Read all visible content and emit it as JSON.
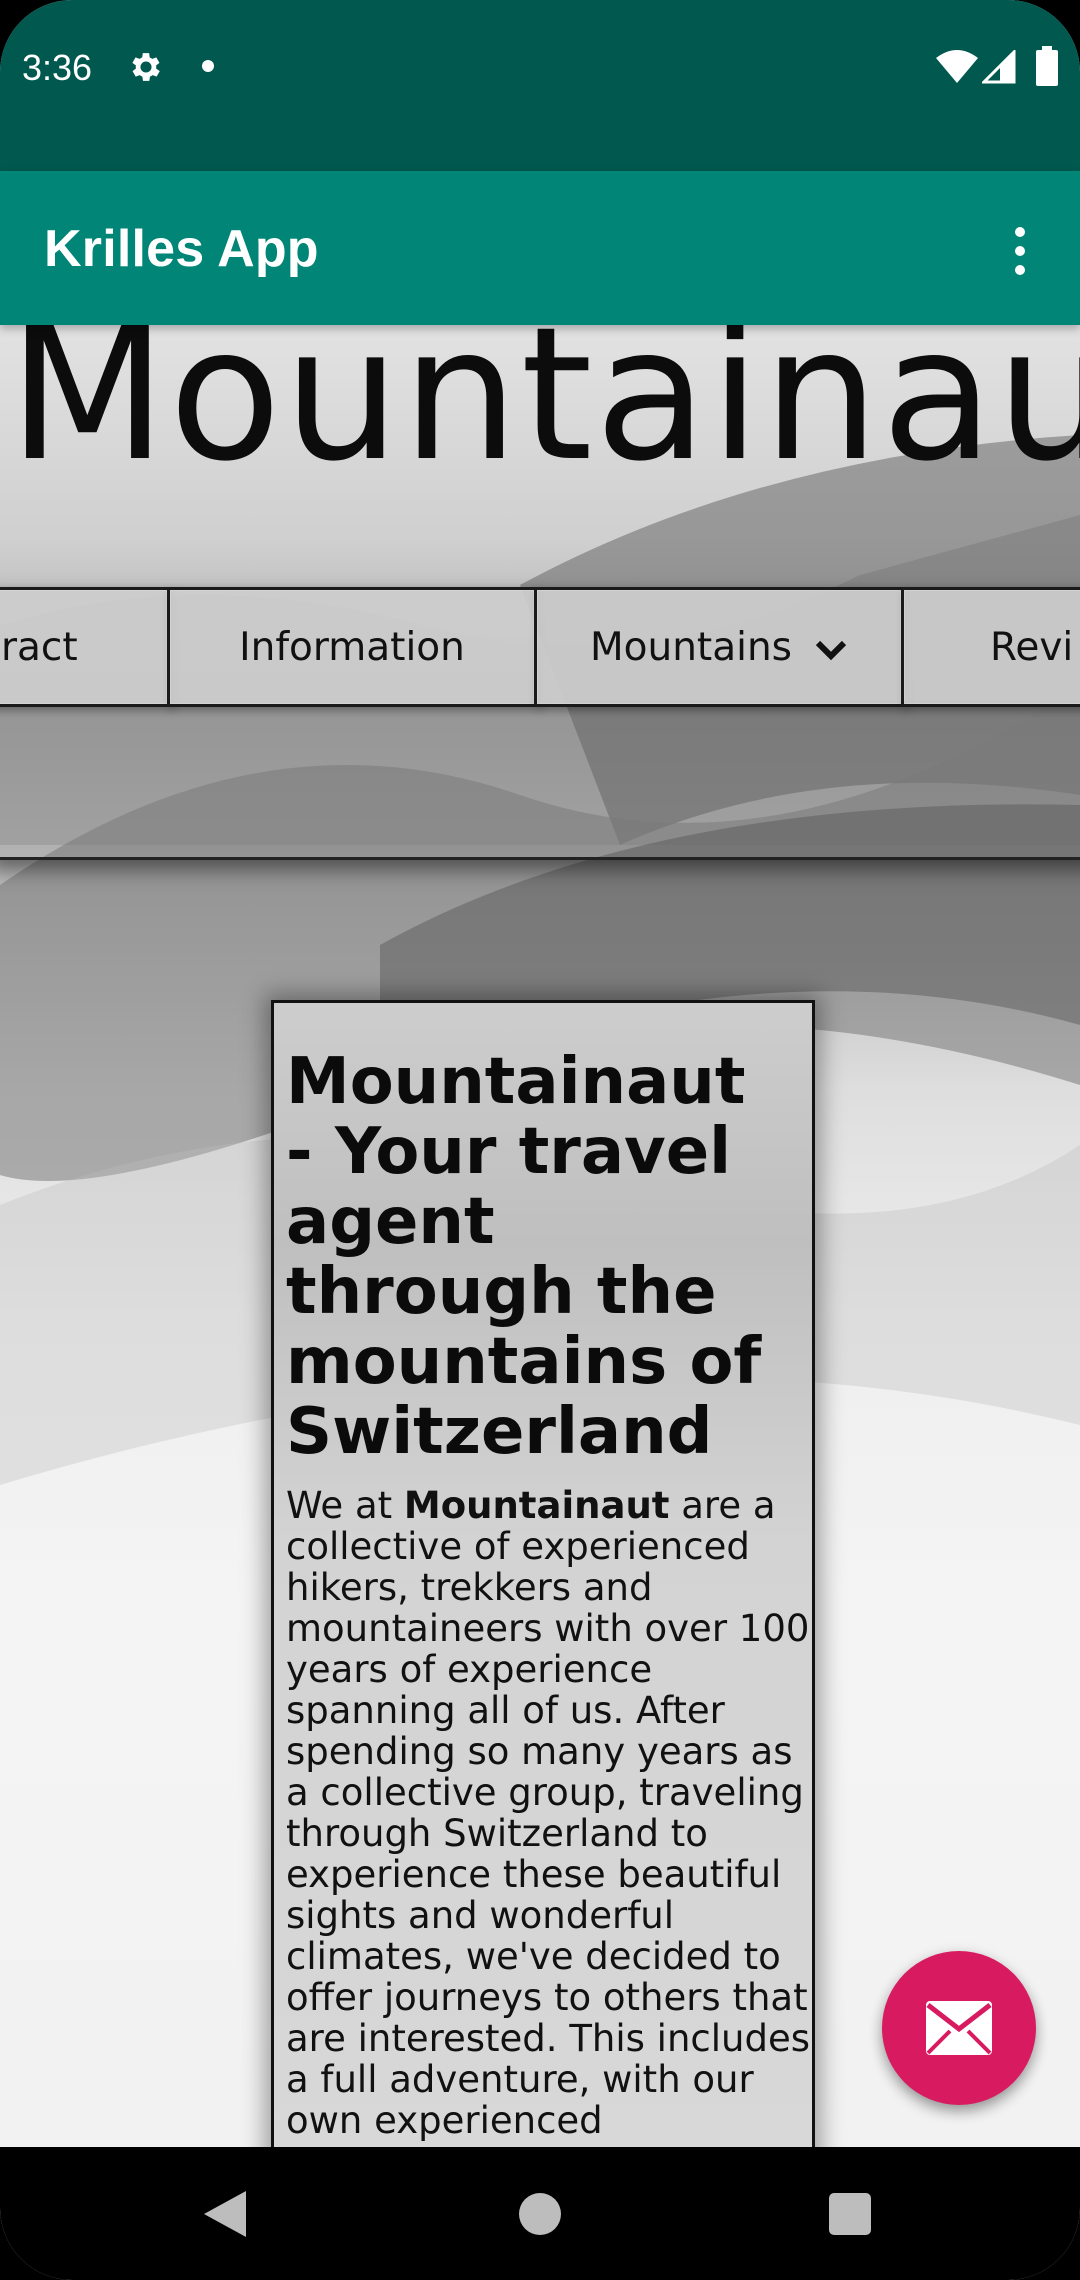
{
  "status_bar": {
    "time": "3:36",
    "icons": [
      "gear-icon",
      "dot-icon",
      "wifi-icon",
      "signal-icon",
      "battery-icon"
    ]
  },
  "app_bar": {
    "title": "Krilles App",
    "menu_icon": "more-vert-icon"
  },
  "web": {
    "hero_title": "Mountainaut",
    "nav": [
      {
        "label": "ract"
      },
      {
        "label": "Information"
      },
      {
        "label": "Mountains",
        "icon": "chevron-down-icon"
      },
      {
        "label": "Revi"
      }
    ],
    "card": {
      "heading": "Mountainaut - Your travel agent through the mountains of Switzerland",
      "body_prefix": "We at ",
      "body_bold": "Mountainaut",
      "body_rest": " are a collective of experienced hikers, trekkers and mountaineers with over 100 years of experience spanning all of us. After spending so many years as a collective group, traveling through Switzerland to experience these beautiful sights and wonderful climates, we've decided to offer journeys to others that are interested. This includes a full adventure, with our own experienced"
    }
  },
  "fab": {
    "icon": "mail-icon"
  },
  "colors": {
    "status_bar": "#00584e",
    "app_bar": "#008577",
    "fab": "#d81b60"
  }
}
